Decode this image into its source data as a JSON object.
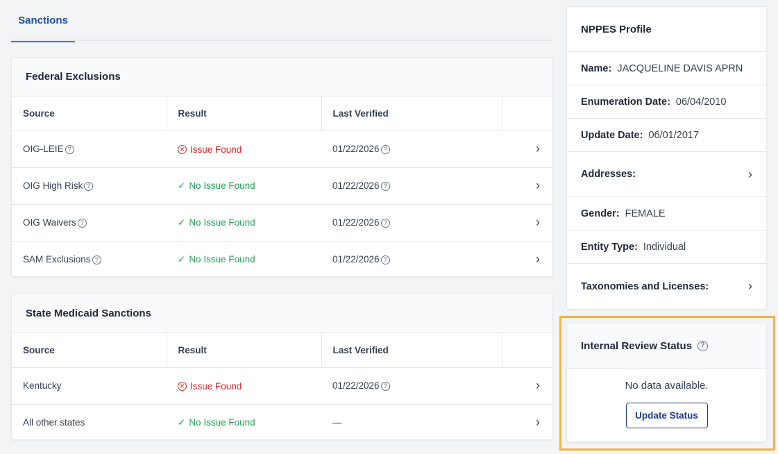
{
  "tabs": [
    {
      "label": "Sanctions"
    }
  ],
  "federal": {
    "title": "Federal Exclusions",
    "columns": [
      "Source",
      "Result",
      "Last Verified"
    ],
    "rows": [
      {
        "source": "OIG-LEIE",
        "result": "Issue Found",
        "status": "issue",
        "verified": "01/22/2026"
      },
      {
        "source": "OIG High Risk",
        "result": "No Issue Found",
        "status": "ok",
        "verified": "01/22/2026"
      },
      {
        "source": "OIG Waivers",
        "result": "No Issue Found",
        "status": "ok",
        "verified": "01/22/2026"
      },
      {
        "source": "SAM Exclusions",
        "result": "No Issue Found",
        "status": "ok",
        "verified": "01/22/2026"
      }
    ]
  },
  "state": {
    "title": "State Medicaid Sanctions",
    "columns": [
      "Source",
      "Result",
      "Last Verified"
    ],
    "rows": [
      {
        "source": "Kentucky",
        "result": "Issue Found",
        "status": "issue",
        "verified": "01/22/2026"
      },
      {
        "source": "All other states",
        "result": "No Issue Found",
        "status": "ok",
        "verified": "—"
      }
    ]
  },
  "nppes": {
    "title": "NPPES Profile",
    "name_label": "Name:",
    "name_value": "JACQUELINE DAVIS APRN",
    "enum_label": "Enumeration Date:",
    "enum_value": "06/04/2010",
    "update_label": "Update Date:",
    "update_value": "06/01/2017",
    "addresses_label": "Addresses:",
    "gender_label": "Gender:",
    "gender_value": "FEMALE",
    "entity_label": "Entity Type:",
    "entity_value": "Individual",
    "taxonomies_label": "Taxonomies and Licenses:"
  },
  "review": {
    "title": "Internal Review Status",
    "message": "No data available.",
    "button": "Update Status"
  },
  "colors": {
    "accent": "#1e4e9c",
    "issue": "#dc2626",
    "ok": "#22a355",
    "highlight": "#f2b33d"
  },
  "icons": {
    "help": "question-circle-icon",
    "issue": "x-circle-icon",
    "ok": "check-icon",
    "row": "chevron-right-icon"
  }
}
